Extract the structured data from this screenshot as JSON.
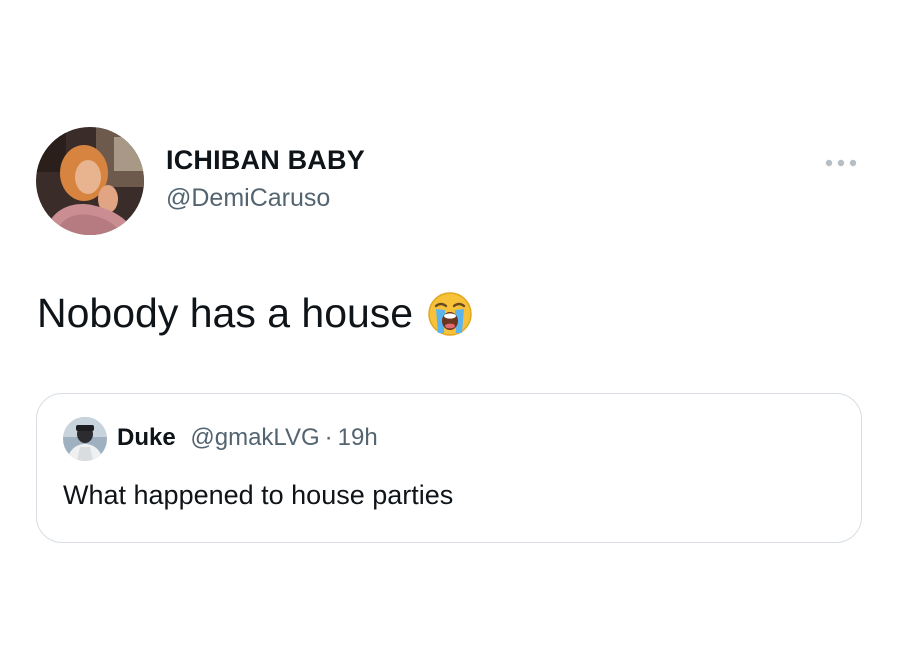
{
  "tweet": {
    "author": {
      "display_name": "ICHIBAN BABY",
      "handle": "@DemiCaruso",
      "avatar_icon": "profile-photo"
    },
    "more_icon": "more-horizontal-icon",
    "text": "Nobody has a house",
    "emoji": "loudly-crying-face-emoji"
  },
  "quoted_tweet": {
    "author": {
      "display_name": "Duke",
      "handle": "@gmakLVG",
      "avatar_icon": "profile-photo"
    },
    "separator": "·",
    "time": "19h",
    "text": "What happened to house parties"
  },
  "colors": {
    "text_primary": "#0f1419",
    "text_secondary": "#536471",
    "border": "#d7dde2"
  }
}
